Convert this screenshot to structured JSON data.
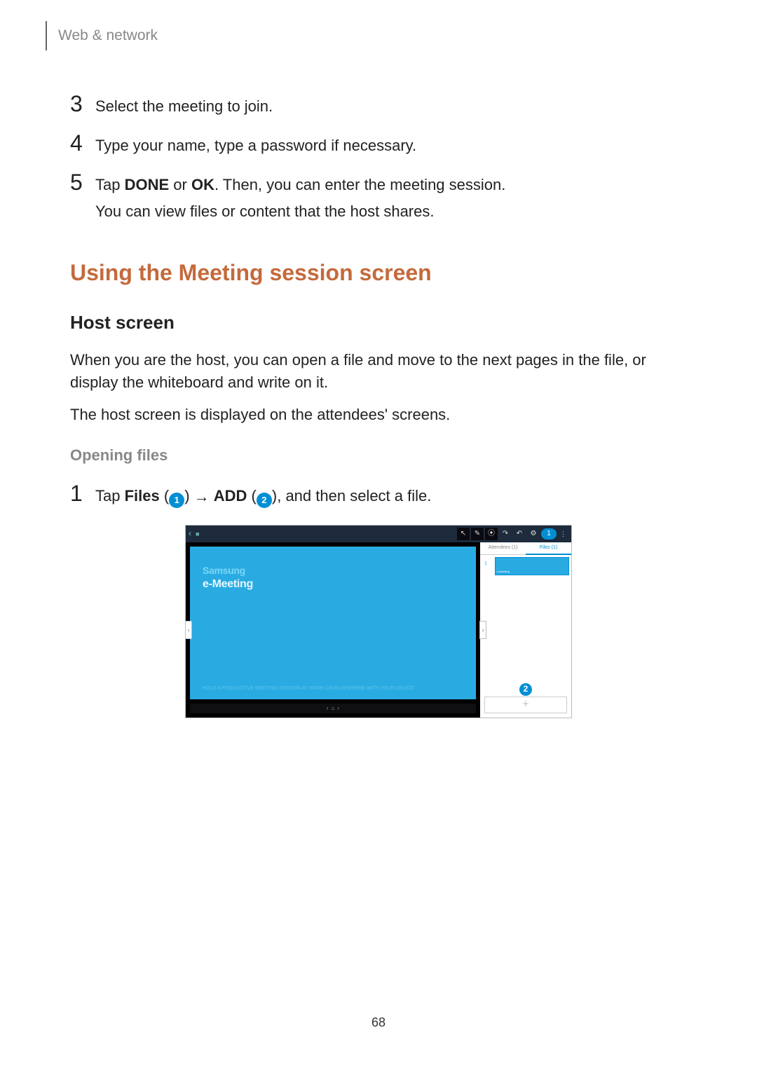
{
  "header": {
    "breadcrumb": "Web & network"
  },
  "steps_prev": [
    {
      "num": "3",
      "lines": [
        "Select the meeting to join."
      ]
    },
    {
      "num": "4",
      "lines": [
        "Type your name, type a password if necessary."
      ]
    },
    {
      "num": "5",
      "lines_rich": {
        "pre": "Tap ",
        "b1": "DONE",
        "mid": " or ",
        "b2": "OK",
        "post": ". Then, you can enter the meeting session."
      },
      "extra": "You can view files or content that the host shares."
    }
  ],
  "h2": "Using the Meeting session screen",
  "h3": "Host screen",
  "p1": "When you are the host, you can open a file and move to the next pages in the file, or display the whiteboard and write on it.",
  "p2": "The host screen is displayed on the attendees' screens.",
  "h4": "Opening files",
  "step1": {
    "num": "1",
    "pre": "Tap ",
    "files_label": "Files",
    "arrow": "→",
    "add_label": "ADD",
    "post": ", and then select a file."
  },
  "callouts": {
    "c1": "1",
    "c2": "2"
  },
  "mock": {
    "toolbar_icons": [
      "↖",
      "✎",
      "⦿",
      "↷",
      "↶",
      "⚙"
    ],
    "slide_t1": "Samsung",
    "slide_t2": "e-Meeting",
    "slide_sub": "HOLD A PRODUCTIVE MEETING SESSION AT WORK OR ELSEWHERE WITH YOUR DEVICE",
    "slide_nav": [
      "‹",
      "⌂",
      "›"
    ],
    "tabs": {
      "left": "Attendees (1)",
      "right": "Files (1)"
    },
    "mini_idx": "1",
    "add_glyph": "＋"
  },
  "page_number": "68"
}
